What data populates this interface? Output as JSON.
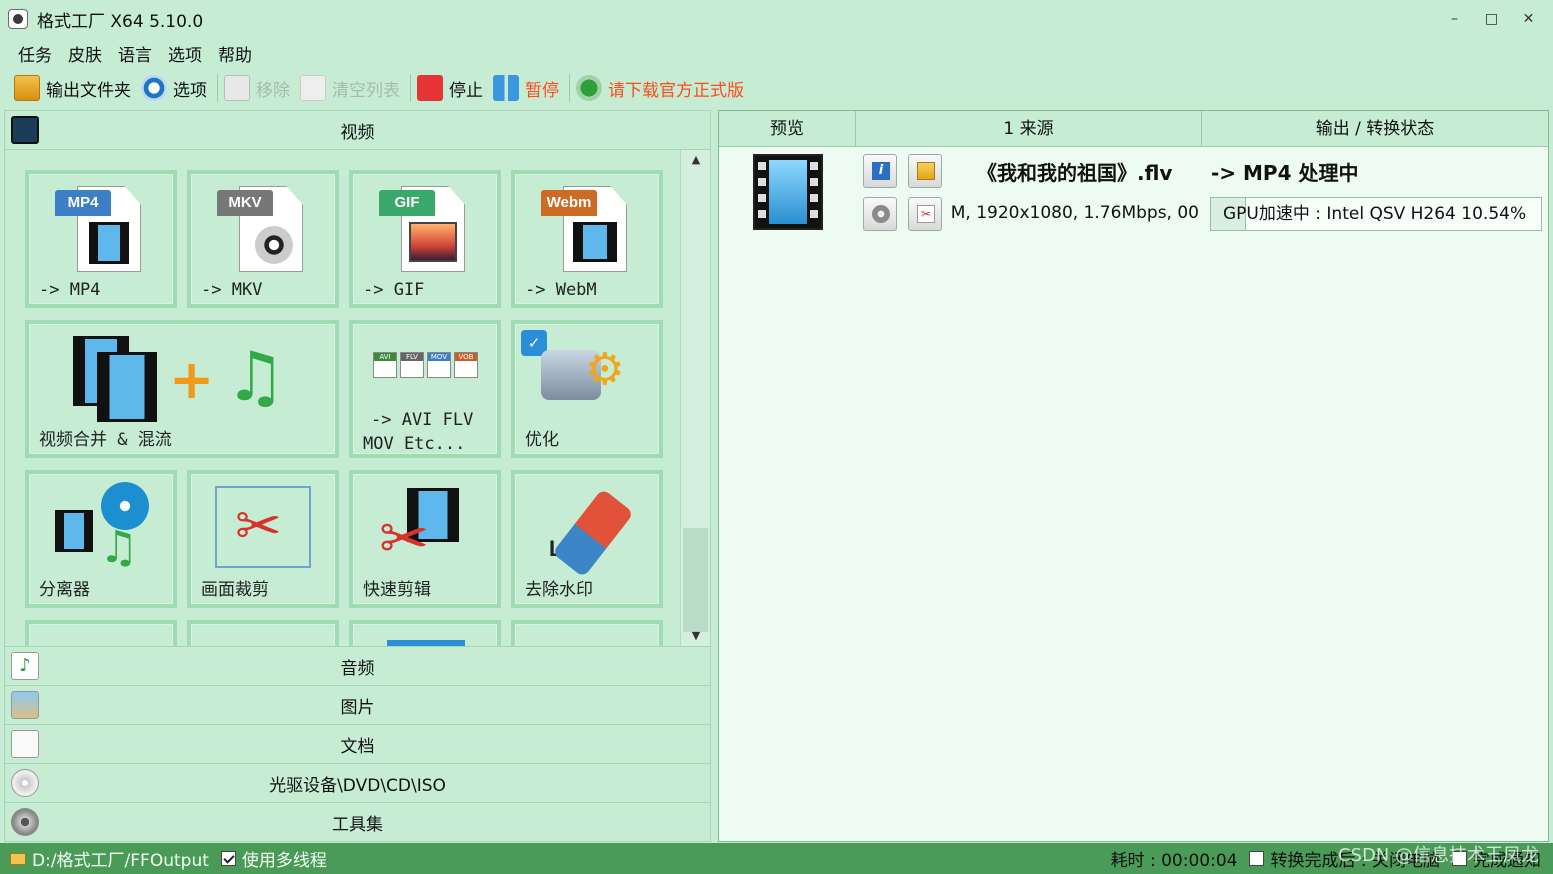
{
  "window": {
    "title": "格式工厂 X64 5.10.0",
    "min": "–",
    "max": "□",
    "close": "✕"
  },
  "menu": [
    "任务",
    "皮肤",
    "语言",
    "选项",
    "帮助"
  ],
  "toolbar": {
    "output_folder": "输出文件夹",
    "options": "选项",
    "remove": "移除",
    "clear_list": "清空列表",
    "stop": "停止",
    "pause": "暂停",
    "download": "请下载官方正式版"
  },
  "left": {
    "video_header": "视频",
    "tiles": [
      {
        "label": "-> MP4",
        "badge": "MP4"
      },
      {
        "label": "-> MKV",
        "badge": "MKV"
      },
      {
        "label": "-> GIF",
        "badge": "GIF"
      },
      {
        "label": "-> WebM",
        "badge": "Webm"
      },
      {
        "label": "视频合并 & 混流"
      },
      {
        "label_line1": "-> AVI FLV",
        "label_line2": "MOV Etc..."
      },
      {
        "label": "优化"
      },
      {
        "label": "分离器"
      },
      {
        "label": "画面裁剪"
      },
      {
        "label": "快速剪辑"
      },
      {
        "label": "去除水印",
        "logo_text": "Logo"
      }
    ],
    "mini_badges": [
      "AVI",
      "FLV",
      "MOV",
      "VOB"
    ],
    "categories": [
      "音频",
      "图片",
      "文档",
      "光驱设备\\DVD\\CD\\ISO",
      "工具集"
    ]
  },
  "right": {
    "columns": [
      "预览",
      "1 来源",
      "输出 / 转换状态"
    ],
    "task": {
      "filename": "《我和我的祖国》.flv",
      "output": "-> MP4 处理中",
      "source_info": "M, 1920x1080, 1.76Mbps, 00",
      "status": "GPU加速中 : Intel QSV H264 10.54%",
      "progress": 0.1054
    }
  },
  "status": {
    "output_path": "D:/格式工厂/FFOutput",
    "multithread": "使用多线程",
    "elapsed": "耗时 : 00:00:04",
    "after_done": "转换完成后 : 关闭电脑",
    "notify": "完成通知",
    "watermark": "CSDN @信息技术王凤龙"
  },
  "colors": {
    "bg": "#c6ecd4",
    "tile_border": "#9fdbb3",
    "statusbar": "#4a9a58",
    "promo": "#ff4b1a"
  }
}
